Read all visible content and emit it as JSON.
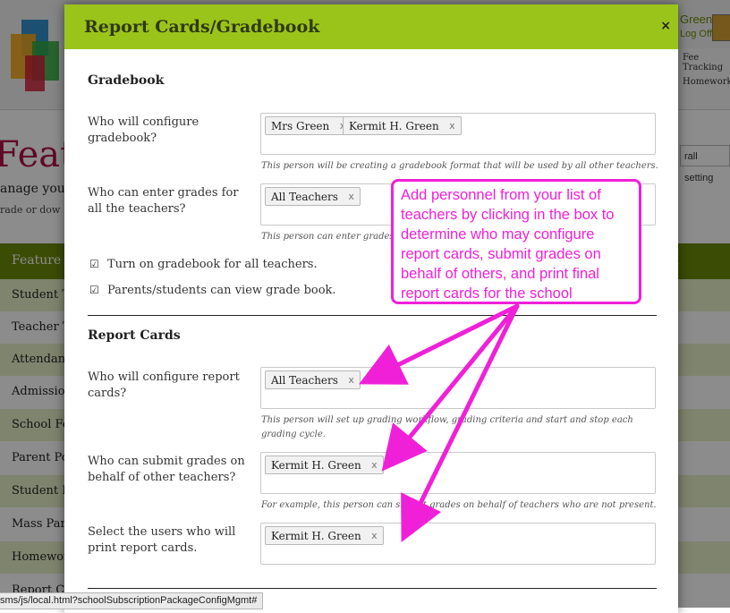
{
  "background": {
    "user_name": "Green",
    "logout_label": "Log Off",
    "top_links": [
      "Fee Tracking",
      "Homework"
    ],
    "page_title_fragment": "Featu",
    "subtitle_fragment": "anage you",
    "subtitle2_fragment": "rade or dow",
    "settings_fragment": "rall setting",
    "table_header": "Feature",
    "table_header_right": "n",
    "rows": [
      "Student T",
      "Teacher T",
      "Attendanc",
      "Admission",
      "School Fe",
      "Parent Po",
      "Student P",
      "Mass Pare",
      "Homewor",
      "Report Ca"
    ]
  },
  "statusbar": "sms/js/local.html?schoolSubscriptionPackageConfigMgmt#",
  "modal": {
    "title": "Report Cards/Gradebook",
    "close_icon": "×",
    "gradebook": {
      "heading": "Gradebook",
      "configure_label": "Who will configure gradebook?",
      "configure_tags": [
        "Mrs Green",
        "Kermit H. Green"
      ],
      "configure_help": "This person will be creating a gradebook format that will be used by all other teachers.",
      "enter_label": "Who can enter grades for all the teachers?",
      "enter_tags": [
        "All Teachers"
      ],
      "enter_help": "This person can enter grades f",
      "check1": "Turn on gradebook for all teachers.",
      "check2": "Parents/students can view grade book."
    },
    "report_cards": {
      "heading": "Report Cards",
      "configure_label": "Who will configure report cards?",
      "configure_tags": [
        "All Teachers"
      ],
      "configure_help": "This person will set up grading workflow, grading criteria and start and stop each grading cycle.",
      "submit_label": "Who can submit grades on behalf of other teachers?",
      "submit_tags": [
        "Kermit H. Green"
      ],
      "submit_help": "For example, this person can submit grades on behalf of teachers who are not present.",
      "print_label": "Select the users who will print report cards.",
      "print_tags": [
        "Kermit H. Green"
      ]
    },
    "tag_remove": "x",
    "check_glyph": "☑"
  },
  "callout": {
    "text": "Add personnel from your list of teachers by clicking in the box to determine who may configure report cards, submit grades on behalf of others, and print final report cards for the school",
    "color": "#f020d8"
  }
}
